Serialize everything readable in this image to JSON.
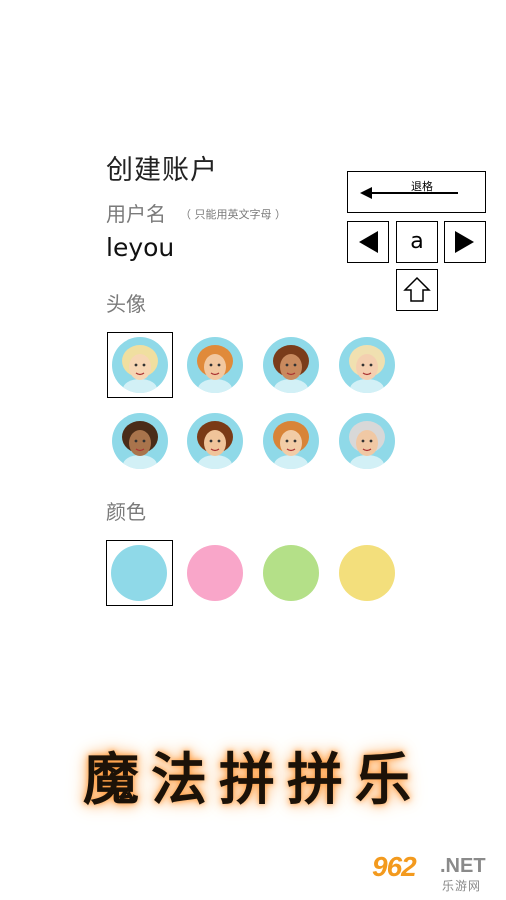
{
  "header": {
    "title": "创建账户"
  },
  "username": {
    "label": "用户名",
    "hint": "（ 只能用英文字母 ）",
    "value": "leyou"
  },
  "avatar_section": {
    "label": "头像",
    "selected_index": 0,
    "avatars": [
      {
        "name": "blonde-girl-avatar",
        "skin": "#f7d6b4",
        "hair": "#f0dfa0"
      },
      {
        "name": "ginger-girl-avatar",
        "skin": "#f2c8a0",
        "hair": "#e08a3a"
      },
      {
        "name": "brown-hair-girl-avatar",
        "skin": "#c98a5e",
        "hair": "#7a3c1a"
      },
      {
        "name": "curly-blonde-girl-avatar",
        "skin": "#f4cfb0",
        "hair": "#f0e0b0"
      },
      {
        "name": "dark-boy-avatar",
        "skin": "#a9744c",
        "hair": "#4a2c18"
      },
      {
        "name": "brown-hair-boy-avatar",
        "skin": "#f0c49a",
        "hair": "#7a3a16"
      },
      {
        "name": "ginger-boy-avatar",
        "skin": "#f2cca6",
        "hair": "#d88438"
      },
      {
        "name": "grandpa-avatar",
        "skin": "#f0c8a4",
        "hair": "#d8d8d8"
      }
    ]
  },
  "color_section": {
    "label": "颜色",
    "selected_index": 0,
    "swatches": [
      {
        "name": "swatch-blue",
        "color": "#8fd9e8"
      },
      {
        "name": "swatch-pink",
        "color": "#f9a6c9"
      },
      {
        "name": "swatch-green",
        "color": "#b4e088"
      },
      {
        "name": "swatch-yellow",
        "color": "#f3df7c"
      }
    ]
  },
  "keyboard": {
    "backspace_label": "退格",
    "current_char": "a",
    "left_icon": "left-triangle-icon",
    "right_icon": "right-triangle-icon",
    "shift_icon": "shift-arrow-icon",
    "backspace_icon": "left-arrow-icon"
  },
  "game_title": "魔法拼拼乐",
  "watermark": {
    "number": "962",
    "domain": ".NET",
    "site_cn": "乐游网"
  }
}
